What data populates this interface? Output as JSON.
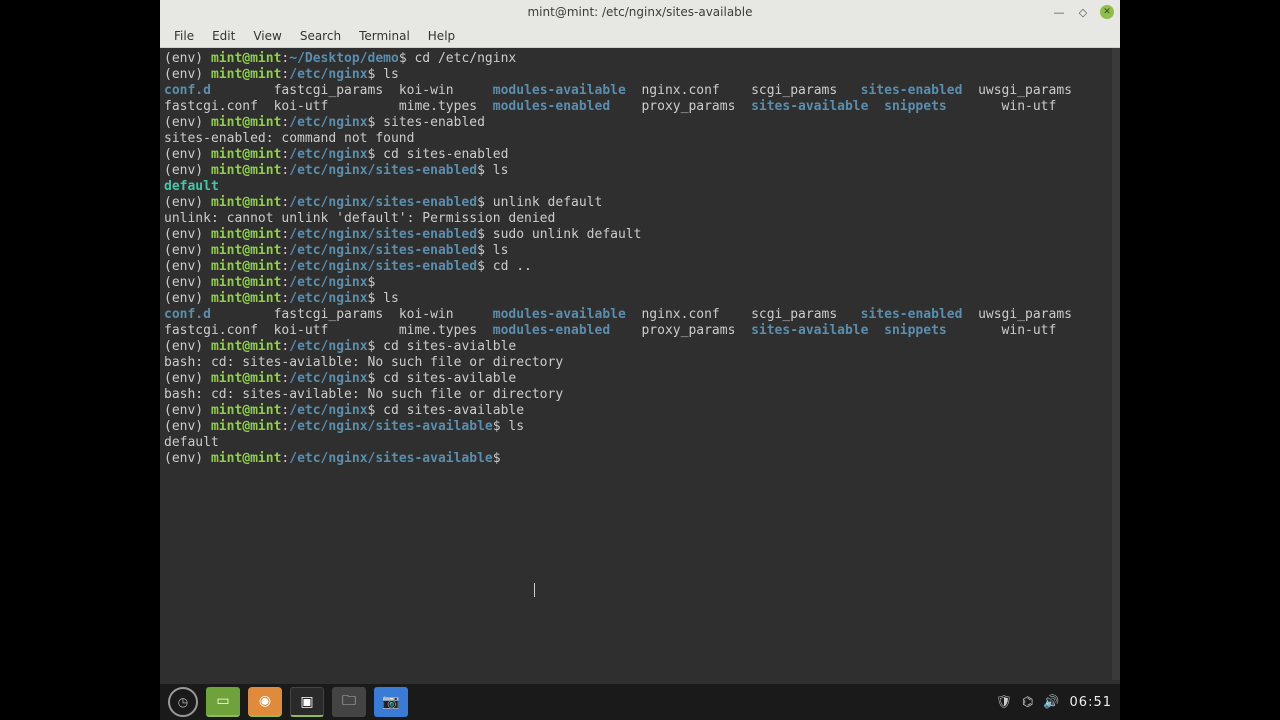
{
  "window": {
    "title": "mint@mint: /etc/nginx/sites-available"
  },
  "menu": {
    "file": "File",
    "edit": "Edit",
    "view": "View",
    "search": "Search",
    "terminal": "Terminal",
    "help": "Help"
  },
  "prompt": {
    "env": "(env) ",
    "user": "mint@mint",
    "sep": ":",
    "dollar": "$",
    "paths": {
      "demo": "~/Desktop/demo",
      "nginx": "/etc/nginx",
      "enabled": "/etc/nginx/sites-enabled",
      "available": "/etc/nginx/sites-available"
    }
  },
  "cmds": {
    "cd_nginx": " cd /etc/nginx",
    "ls": " ls",
    "sites_enabled": " sites-enabled",
    "cd_enabled": " cd sites-enabled",
    "unlink": " unlink default",
    "sudo_unlink": " sudo unlink default",
    "cd_up": " cd ..",
    "cd_avialble": " cd sites-avialble",
    "cd_avilable": " cd sites-avilable",
    "cd_available": " cd sites-available",
    "blank": ""
  },
  "output": {
    "ls_nginx": {
      "row1": {
        "confd": "conf.d",
        "fastcgi_params": "fastcgi_params",
        "koi_win": "koi-win",
        "mod_avail": "modules-available",
        "nginx_conf": "nginx.conf",
        "scgi_params": "scgi_params",
        "sites_enabled": "sites-enabled",
        "uwsgi_params": "uwsgi_params"
      },
      "row2": {
        "fastcgi_conf": "fastcgi.conf",
        "koi_utf": "koi-utf",
        "mime_types": "mime.types",
        "mod_enabled": "modules-enabled",
        "proxy_params": "proxy_params",
        "sites_available": "sites-available",
        "snippets": "snippets",
        "win_utf": "win-utf"
      }
    },
    "cmd_not_found": "sites-enabled: command not found",
    "default_link": "default",
    "unlink_denied": "unlink: cannot unlink 'default': Permission denied",
    "no_dir_avialble": "bash: cd: sites-avialble: No such file or directory",
    "no_dir_avilable": "bash: cd: sites-avilable: No such file or directory",
    "default_file": "default"
  },
  "panel": {
    "clock": "06:51"
  }
}
